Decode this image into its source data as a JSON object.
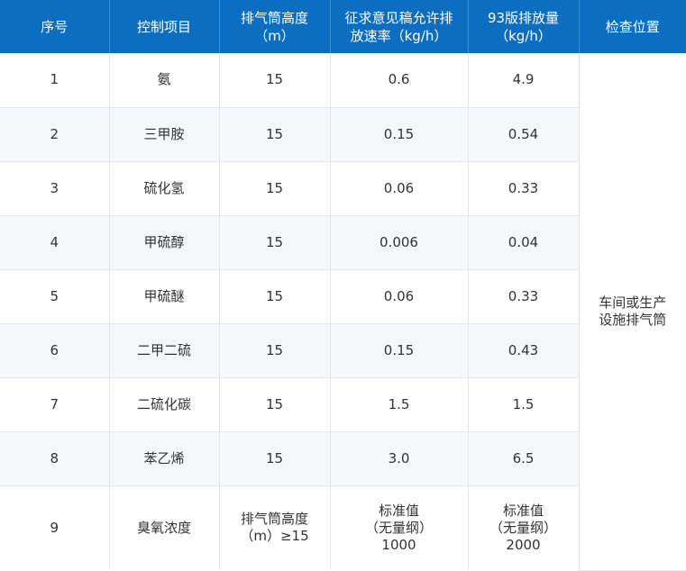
{
  "table": {
    "headers": [
      [
        "序号"
      ],
      [
        "控制项目"
      ],
      [
        "排气筒高度",
        "（m）"
      ],
      [
        "征求意见稿允许排",
        "放速率（kg/h）"
      ],
      [
        "93版排放量",
        "（kg/h）"
      ],
      [
        "检查位置"
      ]
    ],
    "rows": [
      {
        "no": "1",
        "item": "氨",
        "height": "15",
        "draft_rate": "0.6",
        "v93": "4.9"
      },
      {
        "no": "2",
        "item": "三甲胺",
        "height": "15",
        "draft_rate": "0.15",
        "v93": "0.54"
      },
      {
        "no": "3",
        "item": "硫化氢",
        "height": "15",
        "draft_rate": "0.06",
        "v93": "0.33"
      },
      {
        "no": "4",
        "item": "甲硫醇",
        "height": "15",
        "draft_rate": "0.006",
        "v93": "0.04"
      },
      {
        "no": "5",
        "item": "甲硫醚",
        "height": "15",
        "draft_rate": "0.06",
        "v93": "0.33"
      },
      {
        "no": "6",
        "item": "二甲二硫",
        "height": "15",
        "draft_rate": "0.15",
        "v93": "0.43"
      },
      {
        "no": "7",
        "item": "二硫化碳",
        "height": "15",
        "draft_rate": "1.5",
        "v93": "1.5"
      },
      {
        "no": "8",
        "item": "苯乙烯",
        "height": "15",
        "draft_rate": "3.0",
        "v93": "6.5"
      }
    ],
    "last_row": {
      "no": "9",
      "item": "臭氧浓度",
      "height": [
        "排气筒高度",
        "（m）≥15"
      ],
      "draft_rate": [
        "标准值",
        "（无量纲）",
        "1000"
      ],
      "v93": [
        "标准值",
        "（无量纲）",
        "2000"
      ]
    },
    "location": [
      "车间或生产",
      "设施排气筒"
    ]
  }
}
